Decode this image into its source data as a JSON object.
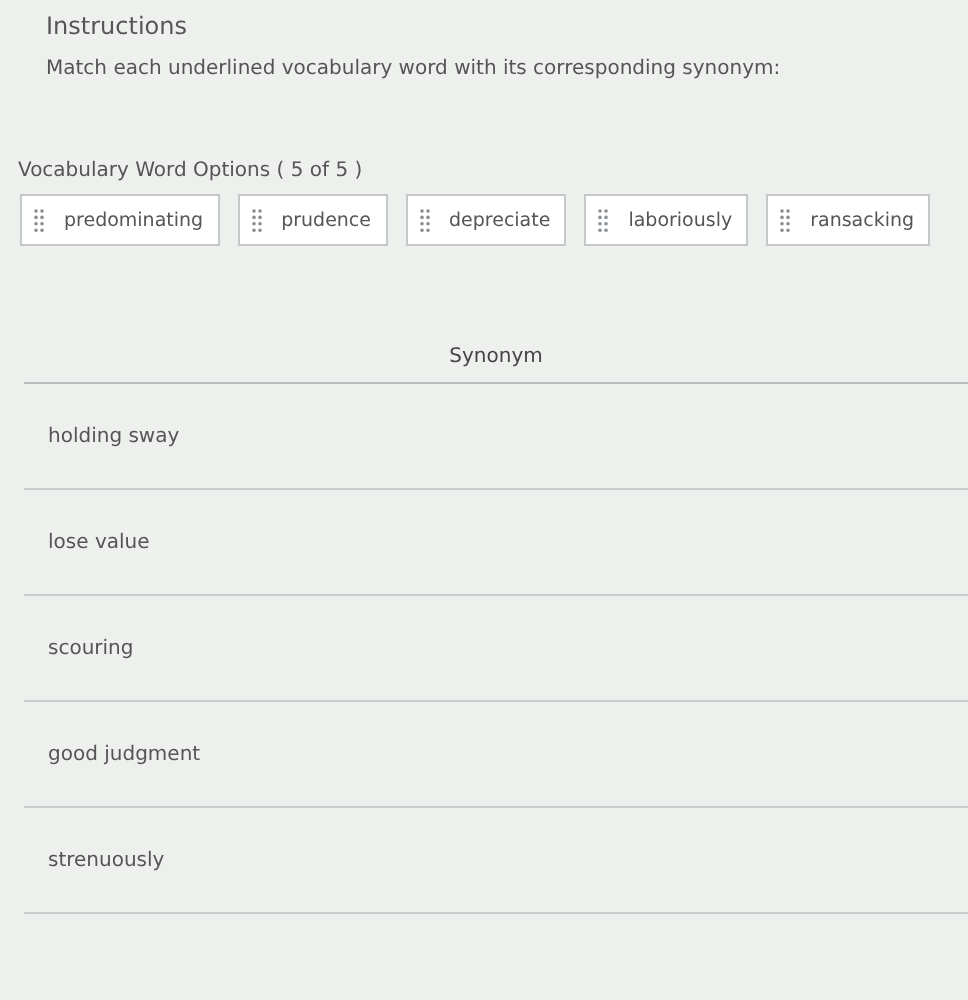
{
  "instructions": {
    "heading": "Instructions",
    "text": "Match each underlined vocabulary word with its corresponding synonym:"
  },
  "options": {
    "label": "Vocabulary Word Options ( 5 of 5 )",
    "items": [
      "predominating",
      "prudence",
      "depreciate",
      "laboriously",
      "ransacking"
    ]
  },
  "table": {
    "columns": [
      "Synonym"
    ],
    "rows": [
      "holding sway",
      "lose value",
      "scouring",
      "good judgment",
      "strenuously"
    ]
  }
}
